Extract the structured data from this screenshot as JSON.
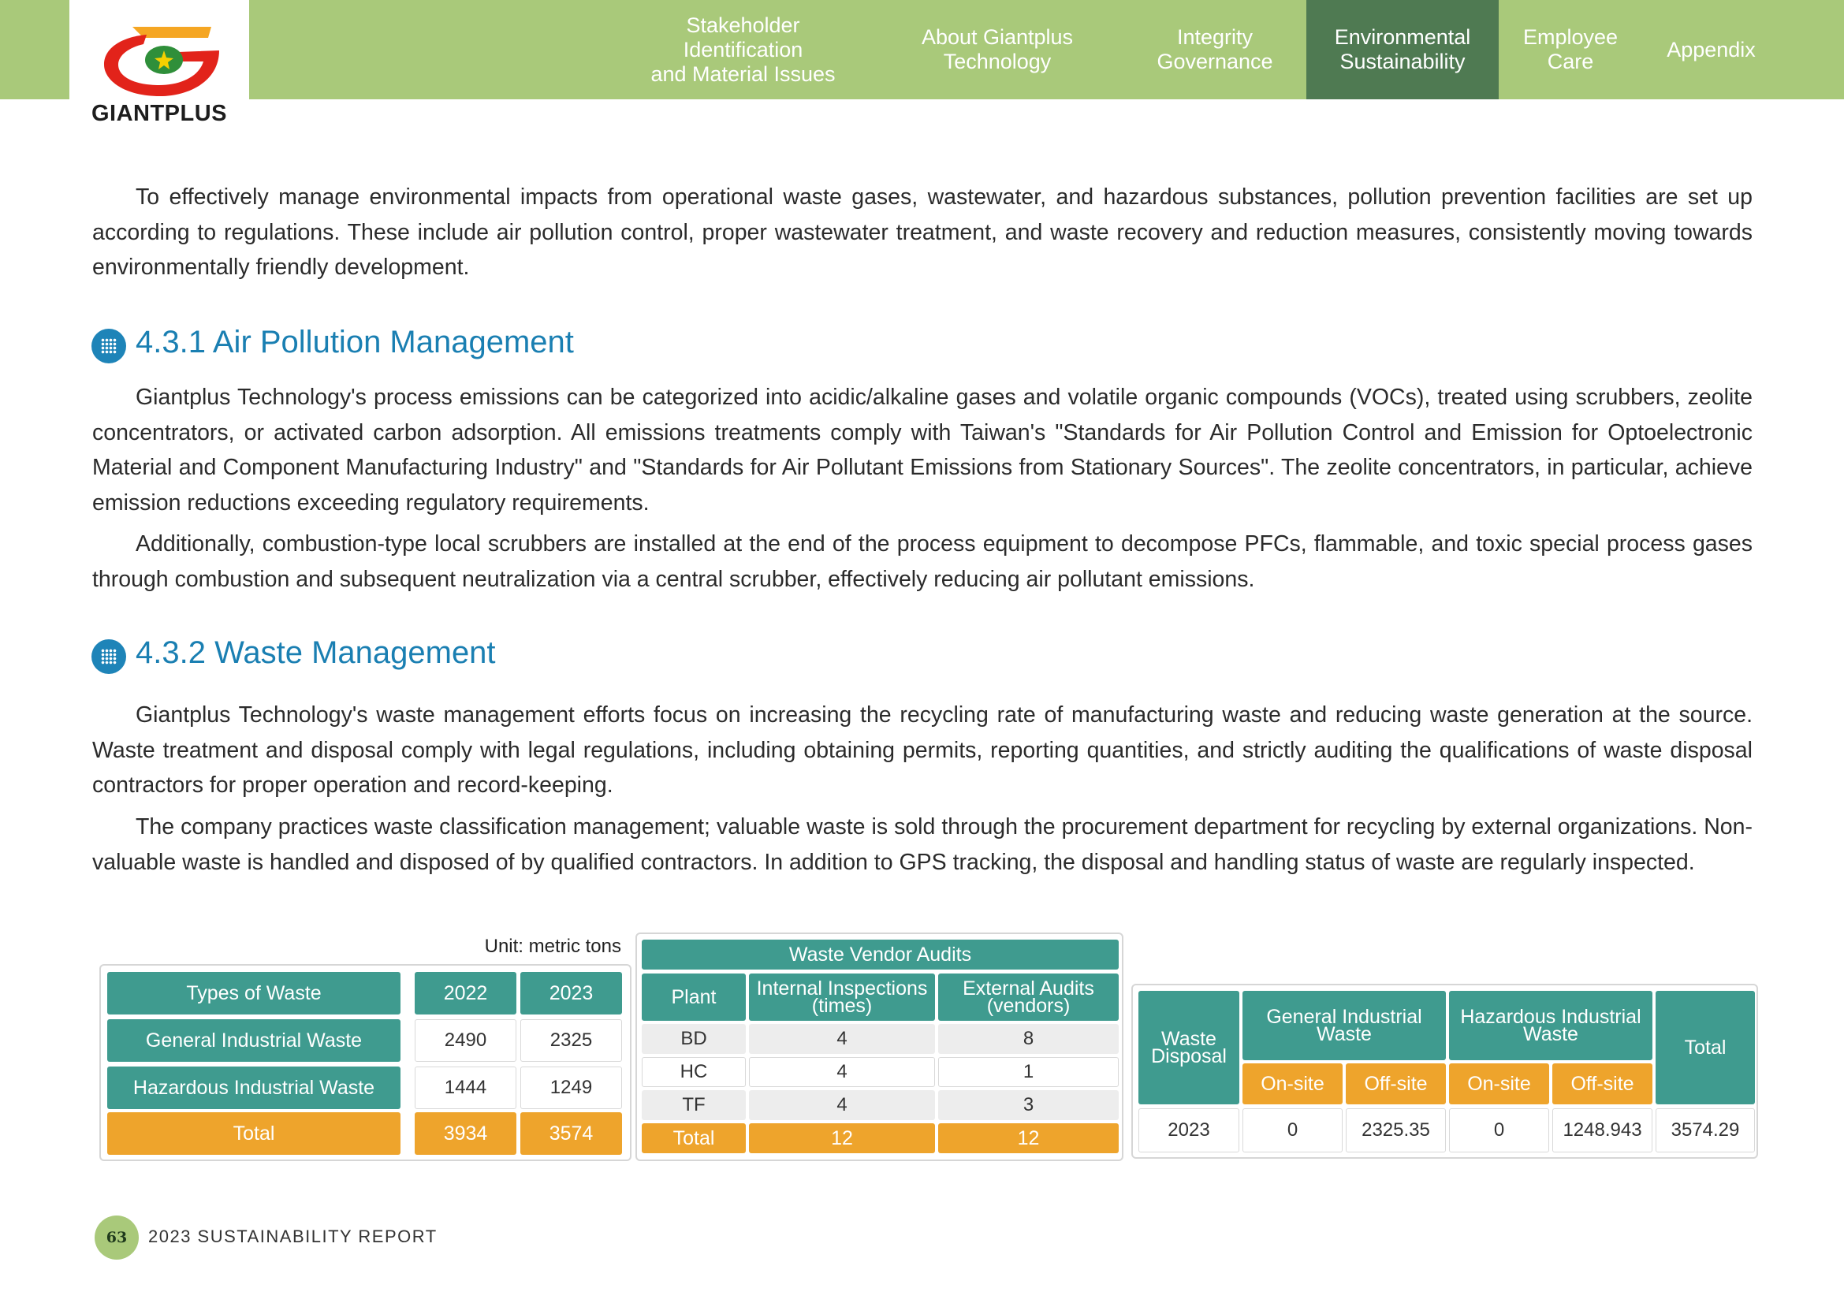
{
  "brand": {
    "name": "GIANTPLUS",
    "colors": {
      "red": "#e2231a",
      "orange": "#f5a623",
      "green": "#2f8f3a"
    }
  },
  "nav": [
    {
      "label": "Stakeholder Identification\nand Material Issues",
      "active": false
    },
    {
      "label": "About Giantplus\nTechnology",
      "active": false
    },
    {
      "label": "Integrity\nGovernance",
      "active": false
    },
    {
      "label": "Environmental\nSustainability",
      "active": true
    },
    {
      "label": "Employee\nCare",
      "active": false
    },
    {
      "label": "Appendix",
      "active": false
    }
  ],
  "intro": "To effectively manage environmental impacts from operational waste gases, wastewater, and hazardous substances, pollution prevention facilities are set up according to regulations. These include air pollution control, proper wastewater treatment, and waste recovery and reduction measures, consistently moving towards environmentally friendly development.",
  "section1": {
    "title": "4.3.1 Air Pollution Management",
    "p1": "Giantplus Technology's process emissions can be categorized into acidic/alkaline gases and volatile organic compounds (VOCs), treated using scrubbers, zeolite concentrators, or activated carbon adsorption. All emissions treatments comply with Taiwan's \"Standards for Air Pollution Control and Emission for Optoelectronic Material and Component Manufacturing Industry\" and \"Standards for Air Pollutant Emissions from Stationary Sources\". The zeolite concentrators, in particular, achieve emission reductions exceeding regulatory requirements.",
    "p2": "Additionally, combustion-type local scrubbers are installed at the end of the process equipment to decompose PFCs, flammable, and toxic special process gases through combustion and subsequent neutralization via a central scrubber, effectively reducing air pollutant emissions."
  },
  "section2": {
    "title": "4.3.2 Waste Management",
    "p1": "Giantplus Technology's waste management efforts focus on increasing the recycling rate of manufacturing waste and reducing waste generation at the source. Waste treatment and disposal comply with legal regulations, including obtaining permits, reporting quantities, and strictly auditing the qualifications of waste disposal contractors for proper operation and record-keeping.",
    "p2": "The company practices waste classification management; valuable waste is sold through the procurement department for recycling by external organizations. Non-valuable waste is handled and disposed of by qualified contractors. In addition to GPS tracking, the disposal and handling status of waste are regularly inspected."
  },
  "table1": {
    "unit": "Unit: metric tons",
    "headers": [
      "Types of Waste",
      "2022",
      "2023"
    ],
    "rows": [
      [
        "General Industrial Waste",
        "2490",
        "2325"
      ],
      [
        "Hazardous Industrial Waste",
        "1444",
        "1249"
      ]
    ],
    "total": [
      "Total",
      "3934",
      "3574"
    ]
  },
  "table2": {
    "title": "Waste Vendor Audits",
    "headers": [
      "Plant",
      "Internal Inspections\n(times)",
      "External Audits\n(vendors)"
    ],
    "rows": [
      [
        "BD",
        "4",
        "8"
      ],
      [
        "HC",
        "4",
        "1"
      ],
      [
        "TF",
        "4",
        "3"
      ]
    ],
    "total": [
      "Total",
      "12",
      "12"
    ]
  },
  "table3": {
    "col0": "Waste\nDisposal",
    "groups": [
      "General Industrial\nWaste",
      "Hazardous Industrial\nWaste"
    ],
    "total_header": "Total",
    "sub": [
      "On-site",
      "Off-site",
      "On-site",
      "Off-site"
    ],
    "row": [
      "2023",
      "0",
      "2325.35",
      "0",
      "1248.943",
      "3574.29"
    ]
  },
  "footer": {
    "page": "63",
    "report": "2023 SUSTAINABILITY REPORT"
  }
}
